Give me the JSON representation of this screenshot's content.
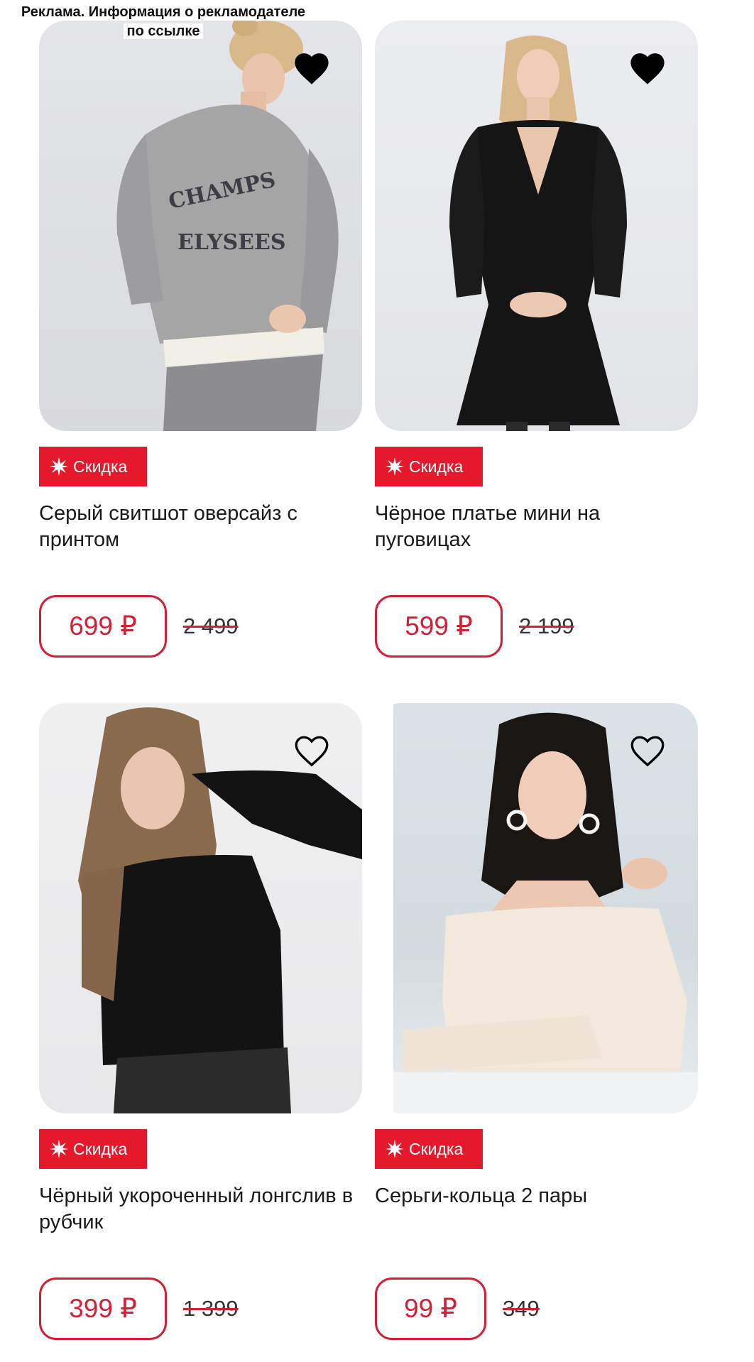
{
  "ad_label": {
    "line1": "Реклама. Информация о рекламодателе",
    "line2": "по ссылке"
  },
  "accent_color": "#e5182c",
  "price_color": "#d41f34",
  "products": [
    {
      "title": "Серый свитшот оверсайз с принтом",
      "badge": "Скидка",
      "price": "699 ₽",
      "old_price": "2 499",
      "favorite": "heart-filled-icon",
      "photo_print": "CHAMPS ELYSEES"
    },
    {
      "title": "Чёрное платье мини на пуговицах",
      "badge": "Скидка",
      "price": "599 ₽",
      "old_price": "2 199",
      "favorite": "heart-filled-icon"
    },
    {
      "title": "Чёрный укороченный лонгслив в рубчик",
      "badge": "Скидка",
      "price": "399 ₽",
      "old_price": "1 399",
      "favorite": "heart-outline-icon"
    },
    {
      "title": "Серьги-кольца 2 пары",
      "badge": "Скидка",
      "price": "99 ₽",
      "old_price": "349",
      "favorite": "heart-outline-icon"
    }
  ]
}
